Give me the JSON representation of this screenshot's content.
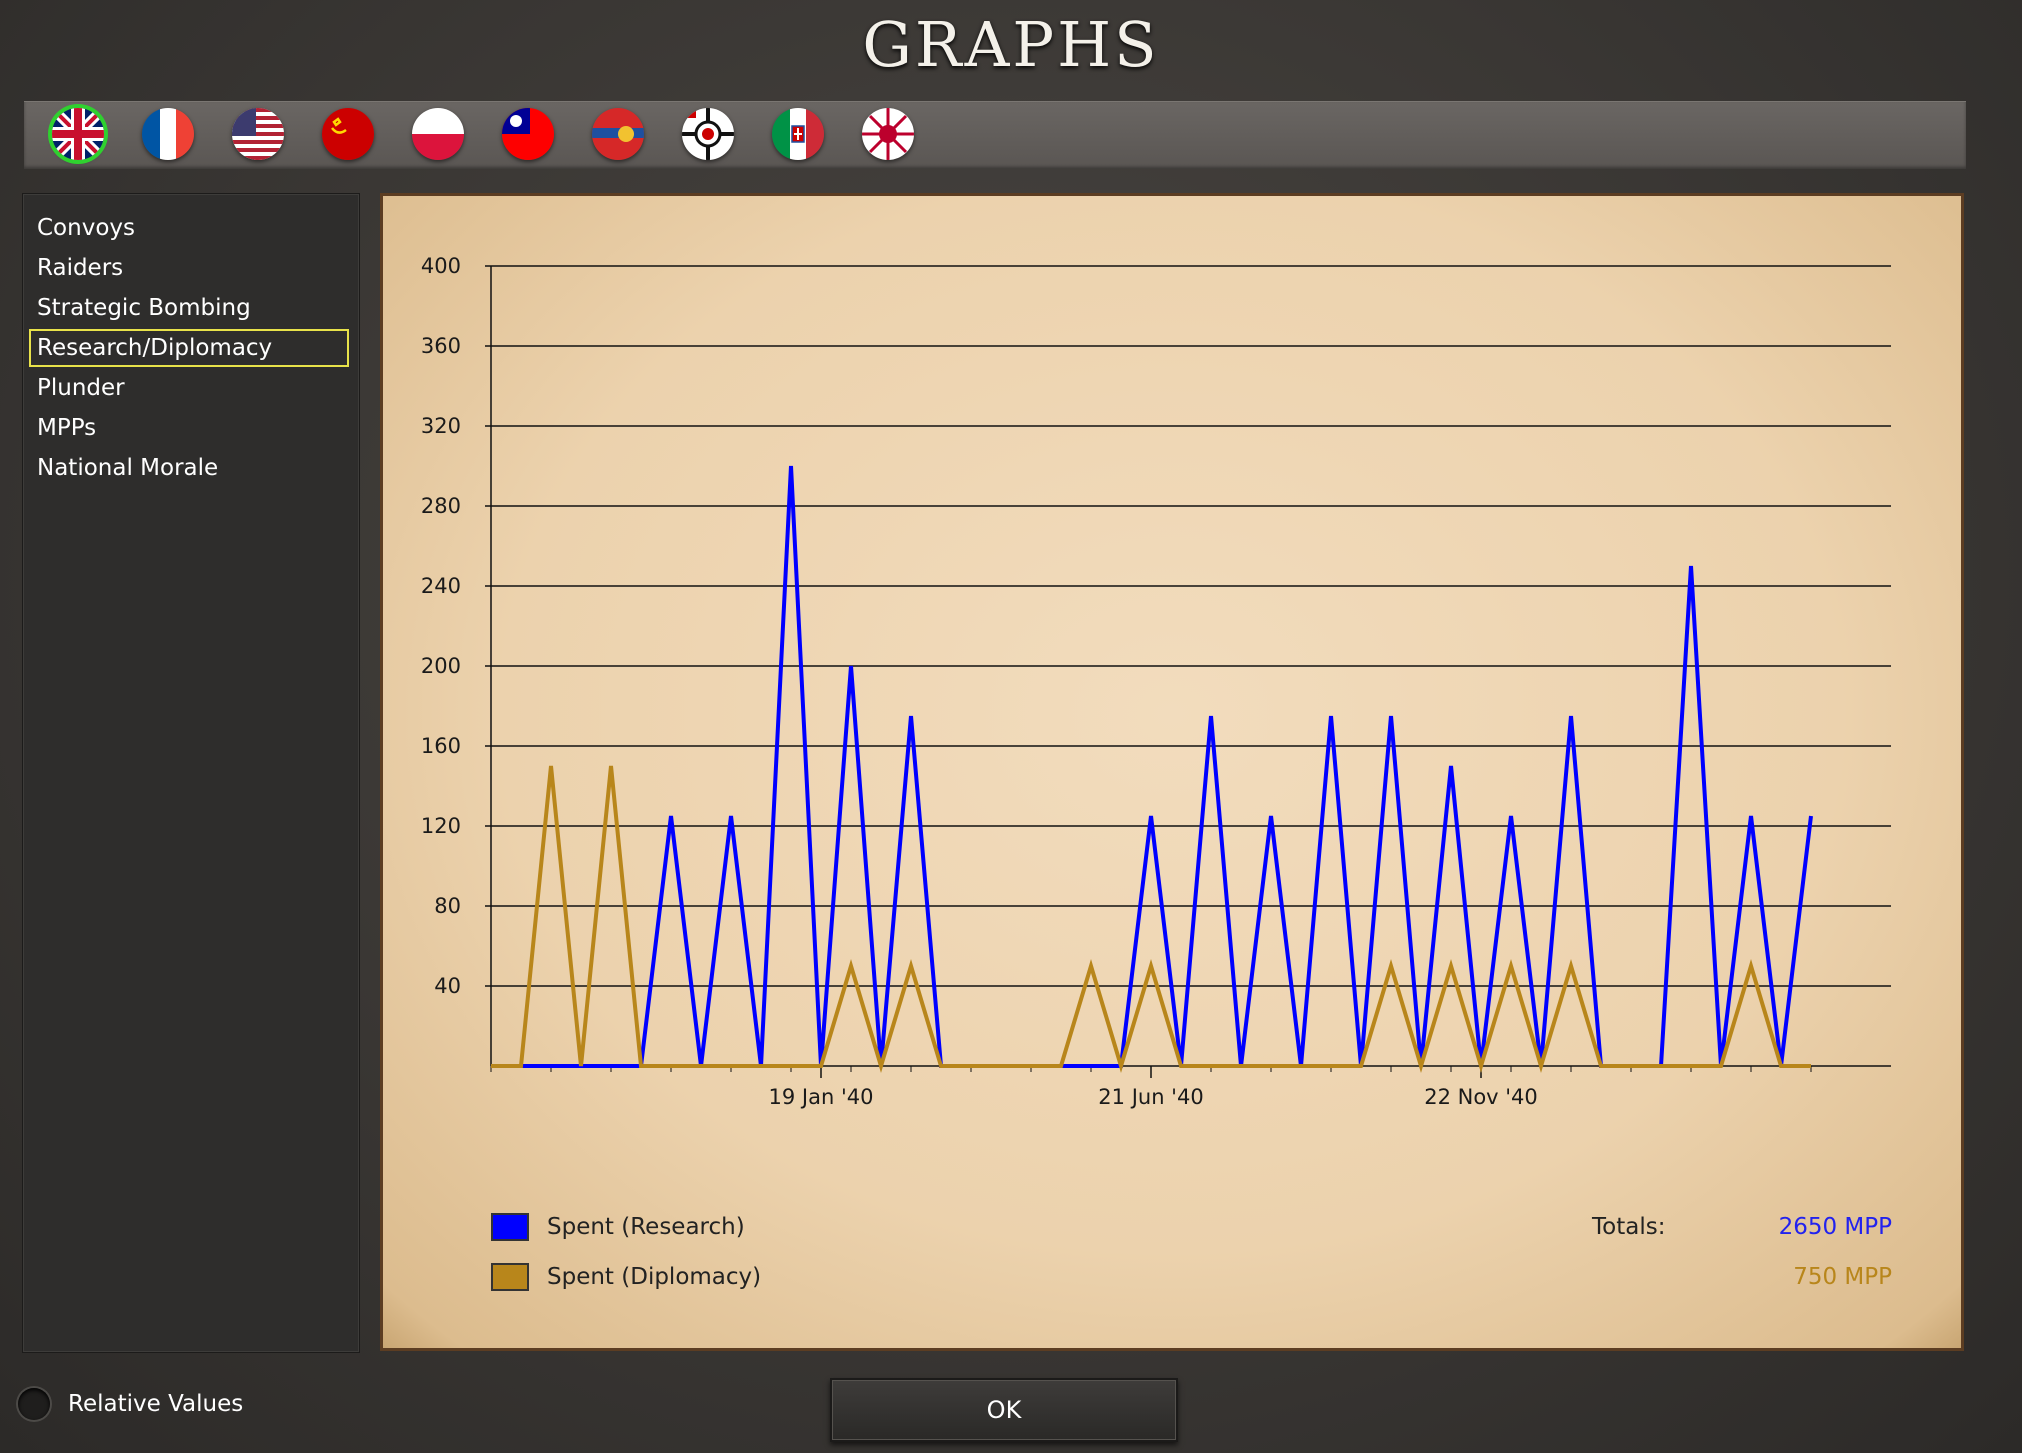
{
  "window": {
    "title": "GRAPHS"
  },
  "flags": [
    {
      "name": "united-kingdom",
      "selected": true
    },
    {
      "name": "france",
      "selected": false
    },
    {
      "name": "united-states",
      "selected": false
    },
    {
      "name": "soviet-union",
      "selected": false
    },
    {
      "name": "poland",
      "selected": false
    },
    {
      "name": "china",
      "selected": false
    },
    {
      "name": "mongolia",
      "selected": false
    },
    {
      "name": "germany",
      "selected": false
    },
    {
      "name": "italy",
      "selected": false
    },
    {
      "name": "japan",
      "selected": false
    }
  ],
  "sidebar": {
    "items": [
      {
        "label": "Convoys",
        "active": false
      },
      {
        "label": "Raiders",
        "active": false
      },
      {
        "label": "Strategic Bombing",
        "active": false
      },
      {
        "label": "Research/Diplomacy",
        "active": true
      },
      {
        "label": "Plunder",
        "active": false
      },
      {
        "label": "MPPs",
        "active": false
      },
      {
        "label": "National Morale",
        "active": false
      }
    ]
  },
  "chart_data": {
    "type": "line",
    "ylim": [
      0,
      400
    ],
    "yticks": [
      40,
      80,
      120,
      160,
      200,
      240,
      280,
      320,
      360,
      400
    ],
    "xtick_labels": [
      {
        "label": "19 Jan '40",
        "index": 11
      },
      {
        "label": "21 Jun '40",
        "index": 22
      },
      {
        "label": "22 Nov '40",
        "index": 33
      }
    ],
    "grid": true,
    "series": [
      {
        "name": "Spent (Research)",
        "color": "#0000ff",
        "values": [
          0,
          0,
          0,
          0,
          0,
          0,
          125,
          0,
          125,
          0,
          300,
          0,
          200,
          0,
          175,
          0,
          0,
          0,
          0,
          0,
          0,
          0,
          125,
          0,
          175,
          0,
          125,
          0,
          175,
          0,
          175,
          0,
          150,
          0,
          125,
          0,
          175,
          0,
          0,
          0,
          250,
          0,
          125,
          0,
          125
        ]
      },
      {
        "name": "Spent (Diplomacy)",
        "color": "#b8861b",
        "values": [
          0,
          0,
          150,
          0,
          150,
          0,
          0,
          0,
          0,
          0,
          0,
          0,
          50,
          0,
          50,
          0,
          0,
          0,
          0,
          0,
          50,
          0,
          50,
          0,
          0,
          0,
          0,
          0,
          0,
          0,
          50,
          0,
          50,
          0,
          50,
          0,
          50,
          0,
          0,
          0,
          0,
          0,
          50,
          0,
          0
        ]
      }
    ]
  },
  "legend": {
    "research_label": "Spent (Research)",
    "diplomacy_label": "Spent (Diplomacy)",
    "research_color": "#0000ff",
    "diplomacy_color": "#b8861b"
  },
  "totals": {
    "label": "Totals:",
    "research": "2650 MPP",
    "diplomacy": "750 MPP"
  },
  "relative_values": {
    "label": "Relative Values",
    "checked": false
  },
  "ok_button": {
    "label": "OK"
  }
}
